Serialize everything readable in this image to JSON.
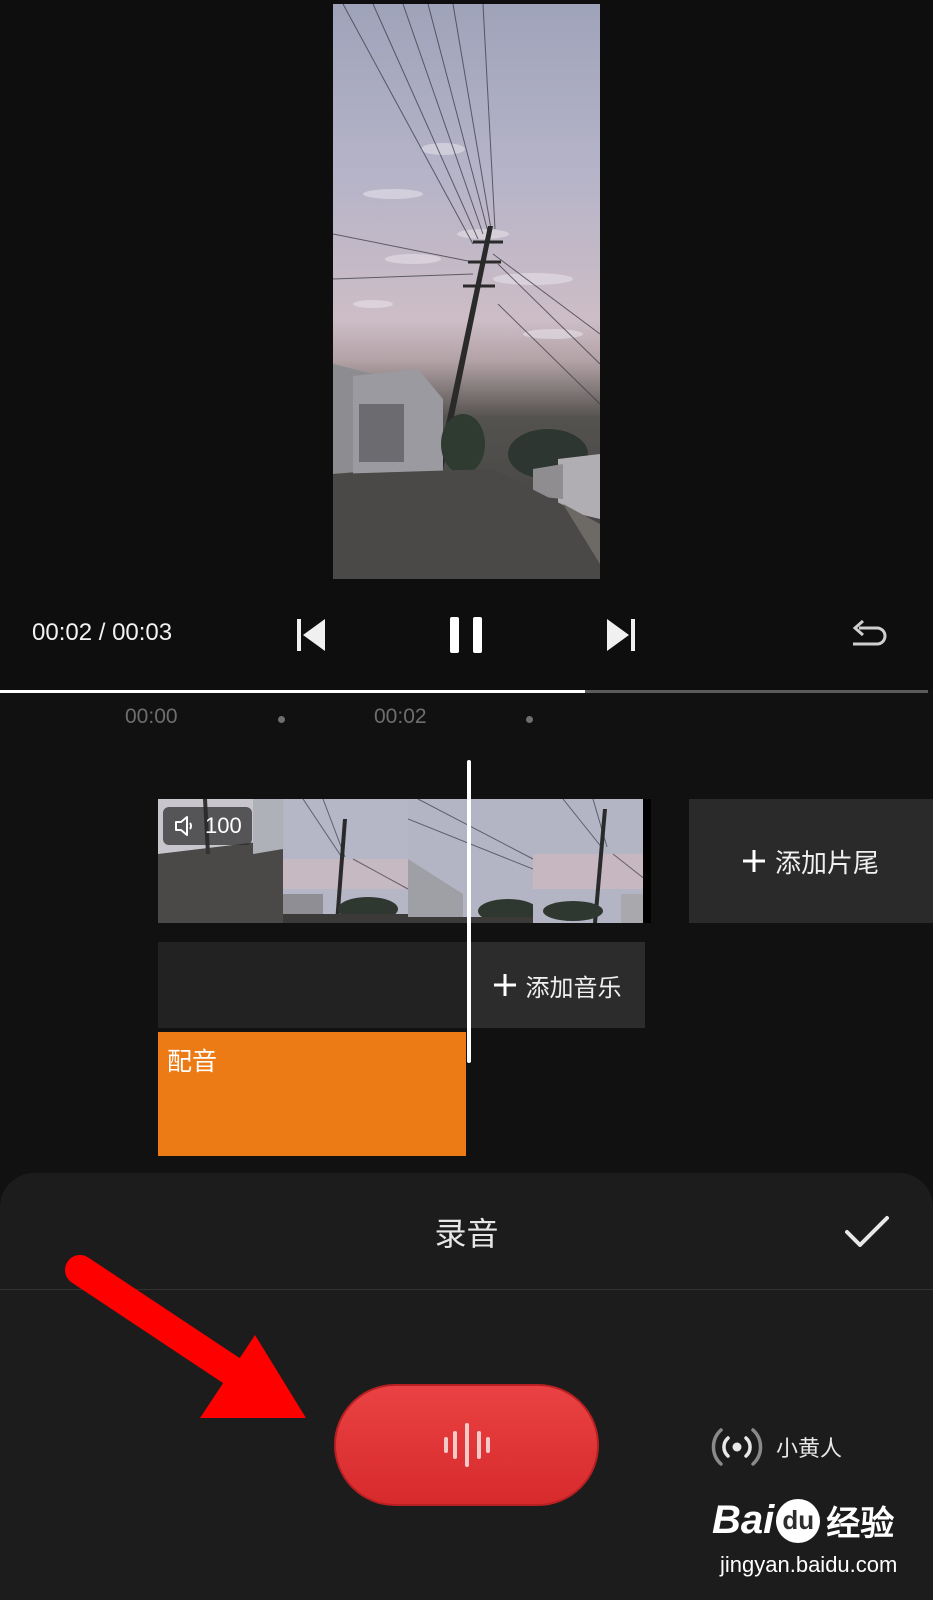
{
  "player": {
    "time_display": "00:02 / 00:03",
    "progress": 0.63
  },
  "timeline": {
    "ticks": [
      "00:00",
      "00:02"
    ],
    "video_volume": "100",
    "add_ending_label": "添加片尾",
    "add_music_label": "添加音乐",
    "dub_clip_label": "配音"
  },
  "sheet": {
    "title": "录音",
    "voice_effect_label": "小黄人"
  },
  "watermark": {
    "brand_bai": "Bai",
    "brand_du": "du",
    "brand_jingyan": "经验",
    "url": "jingyan.baidu.com"
  },
  "colors": {
    "background": "#111111",
    "sheet": "#1c1c1c",
    "dub_clip": "#ec7a15",
    "record_button": "#e03436",
    "annotation_arrow": "#ff0000"
  },
  "icons": [
    "skip-back-icon",
    "pause-icon",
    "skip-forward-icon",
    "undo-icon",
    "speaker-icon",
    "plus-icon",
    "checkmark-icon",
    "sound-wave-icon",
    "broadcast-icon",
    "arrow-annotation"
  ]
}
